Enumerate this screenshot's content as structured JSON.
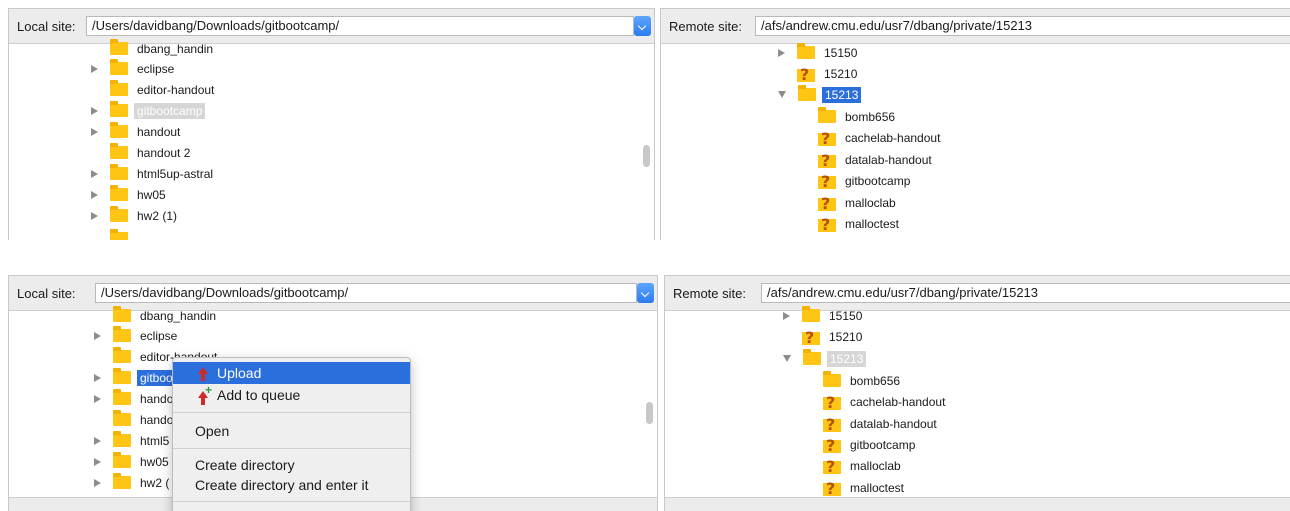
{
  "top": {
    "local": {
      "label": "Local site:",
      "path": "/Users/davidbang/Downloads/gitbootcamp/",
      "items": [
        {
          "name": "dbang_handin",
          "expander": "none"
        },
        {
          "name": "eclipse",
          "expander": "right"
        },
        {
          "name": "editor-handout",
          "expander": "none"
        },
        {
          "name": "gitbootcamp",
          "expander": "right"
        },
        {
          "name": "handout",
          "expander": "right"
        },
        {
          "name": "handout 2",
          "expander": "none"
        },
        {
          "name": "html5up-astral",
          "expander": "right"
        },
        {
          "name": "hw05",
          "expander": "right"
        },
        {
          "name": "hw2 (1)",
          "expander": "right"
        }
      ]
    },
    "remote": {
      "label": "Remote site:",
      "path": "/afs/andrew.cmu.edu/usr7/dbang/private/15213",
      "items": [
        {
          "name": "15150",
          "expander": "right",
          "icon": "folder"
        },
        {
          "name": "15210",
          "expander": "none",
          "icon": "unknown-folder"
        },
        {
          "name": "15213",
          "expander": "down",
          "icon": "folder"
        },
        {
          "name": "bomb656",
          "icon": "folder"
        },
        {
          "name": "cachelab-handout",
          "icon": "unknown-folder"
        },
        {
          "name": "datalab-handout",
          "icon": "unknown-folder"
        },
        {
          "name": "gitbootcamp",
          "icon": "unknown-folder"
        },
        {
          "name": "malloclab",
          "icon": "unknown-folder"
        },
        {
          "name": "malloctest",
          "icon": "unknown-folder"
        }
      ]
    }
  },
  "bottom": {
    "local": {
      "label": "Local site:",
      "path": "/Users/davidbang/Downloads/gitbootcamp/",
      "items": [
        {
          "name": "dbang_handin"
        },
        {
          "name": "eclipse"
        },
        {
          "name": "editor-handout"
        },
        {
          "name": "gitboo"
        },
        {
          "name": "hando"
        },
        {
          "name": "hando"
        },
        {
          "name": "html5"
        },
        {
          "name": "hw05"
        },
        {
          "name": "hw2 ("
        }
      ]
    },
    "remote": {
      "label": "Remote site:",
      "path": "/afs/andrew.cmu.edu/usr7/dbang/private/15213",
      "items": [
        {
          "name": "15150"
        },
        {
          "name": "15210"
        },
        {
          "name": "15213"
        },
        {
          "name": "bomb656"
        },
        {
          "name": "cachelab-handout"
        },
        {
          "name": "datalab-handout"
        },
        {
          "name": "gitbootcamp"
        },
        {
          "name": "malloclab"
        },
        {
          "name": "malloctest"
        }
      ]
    },
    "context_menu": {
      "upload": "Upload",
      "add_to_queue": "Add to queue",
      "open": "Open",
      "create_directory": "Create directory",
      "create_directory_enter": "Create directory and enter it"
    }
  },
  "colors": {
    "selection": "#2a6fdb",
    "folder": "#ffc514",
    "toolbar": "#ececec"
  }
}
